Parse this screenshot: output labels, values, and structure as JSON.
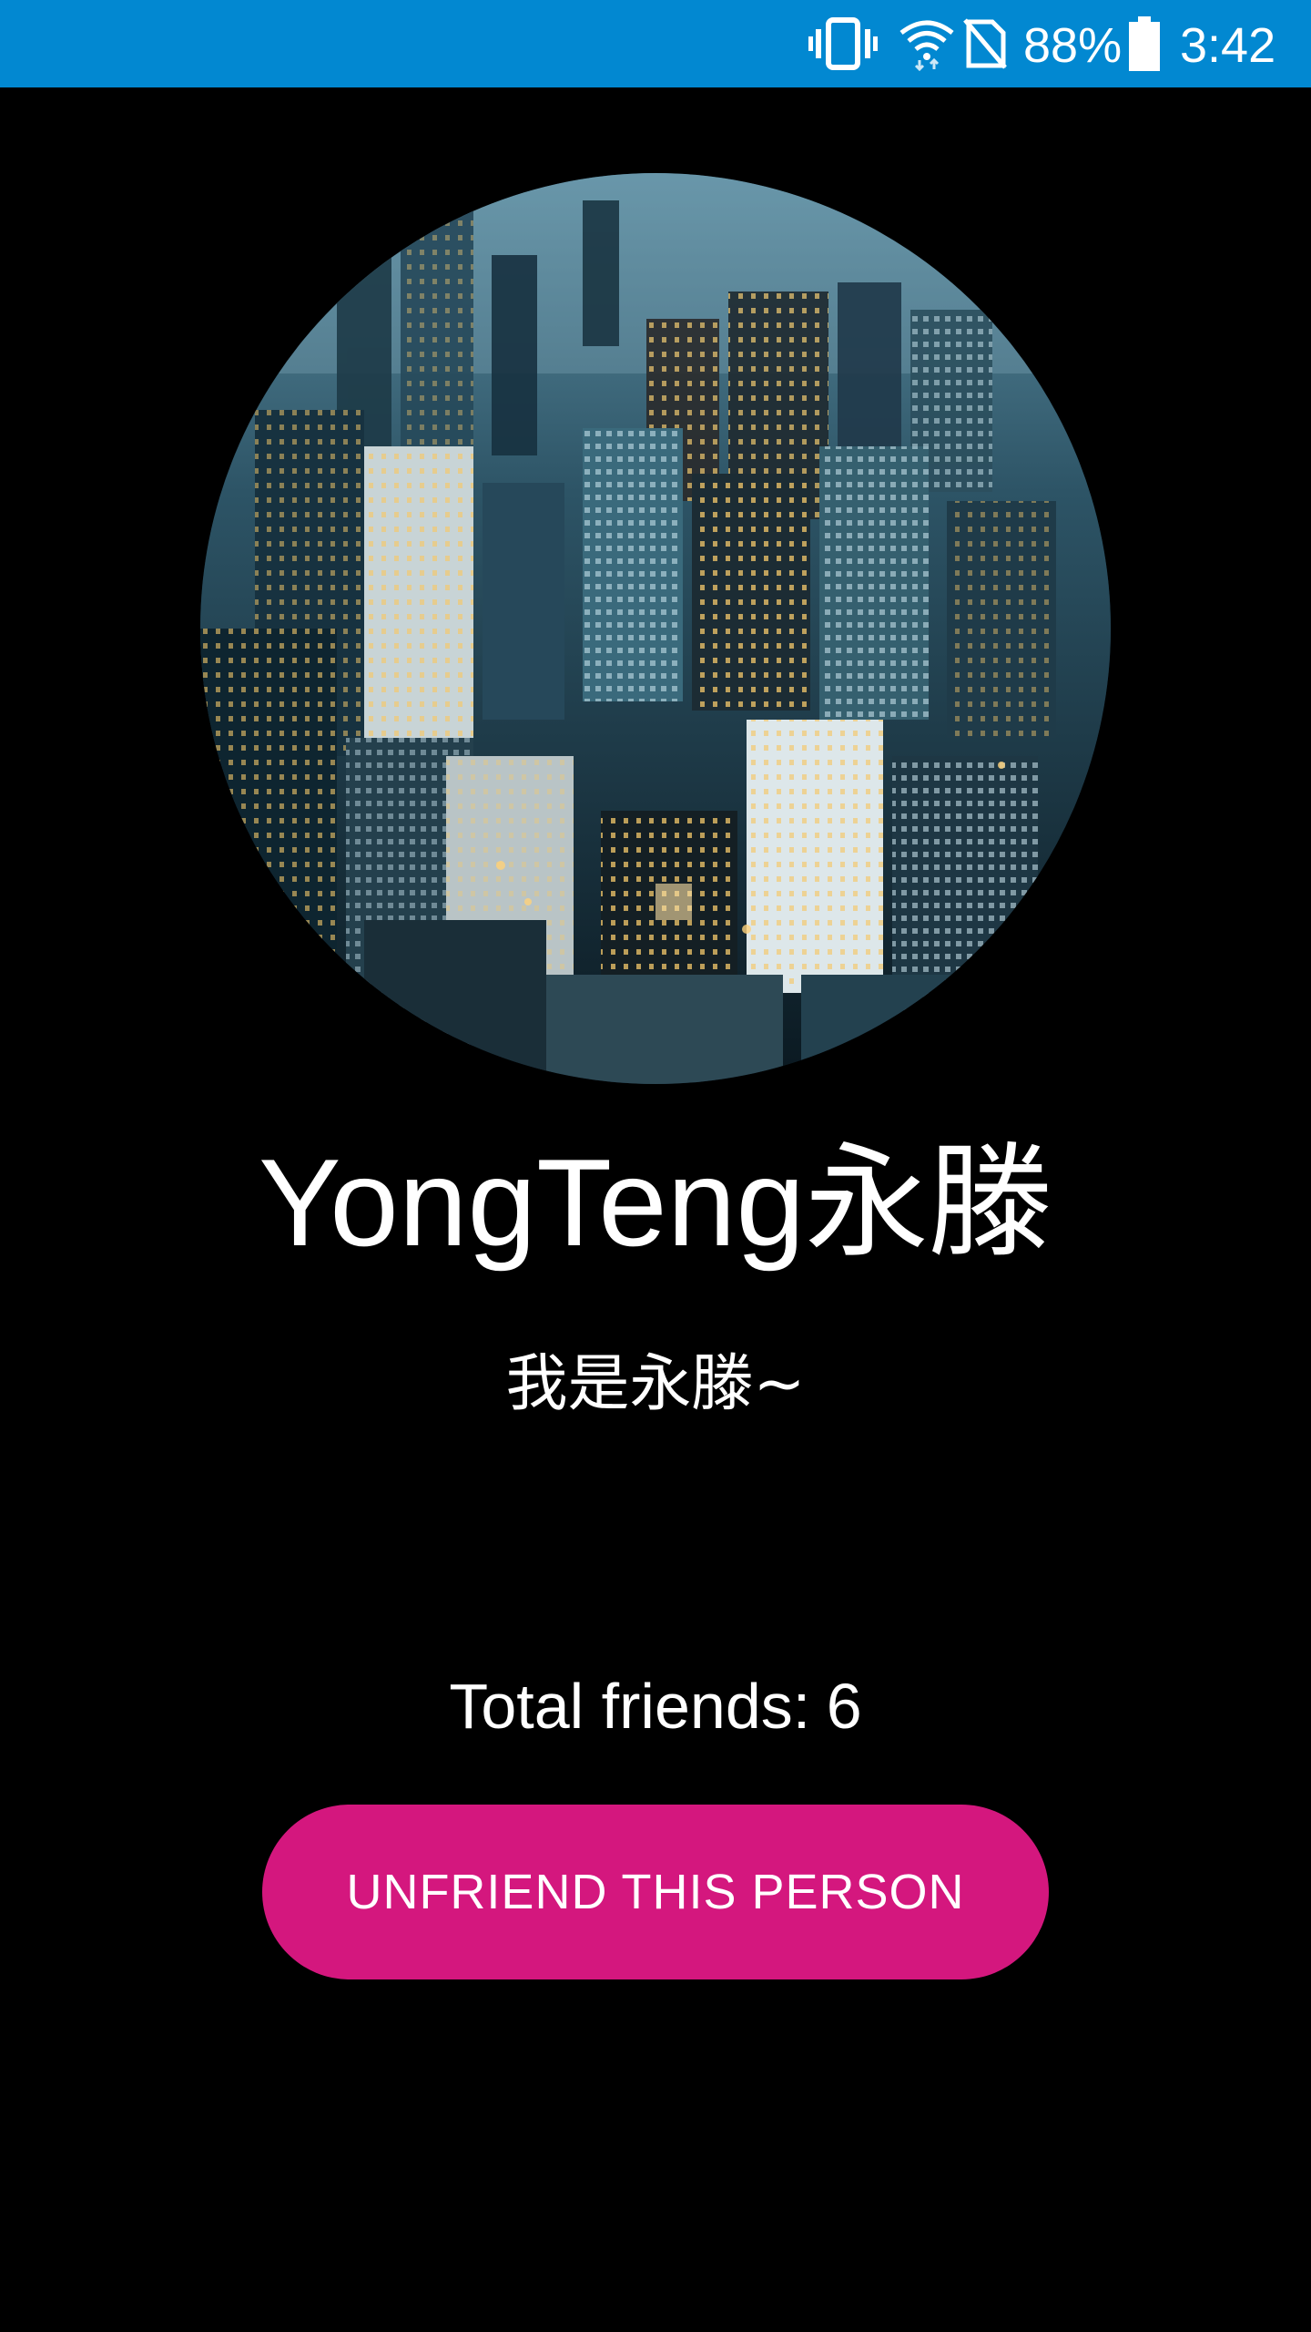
{
  "status_bar": {
    "battery_percent": "88%",
    "time": "3:42",
    "background_color": "#0288d1",
    "icons": [
      "vibrate-icon",
      "wifi-icon",
      "no-sim-icon",
      "battery-icon"
    ]
  },
  "profile": {
    "avatar": "city-skyline-photo",
    "name": "YongTeng永滕",
    "status_message": "我是永滕~",
    "friends_label": "Total friends:",
    "friends_count": "6"
  },
  "actions": {
    "unfriend_label": "UNFRIEND THIS PERSON",
    "unfriend_color": "#d4177e"
  }
}
